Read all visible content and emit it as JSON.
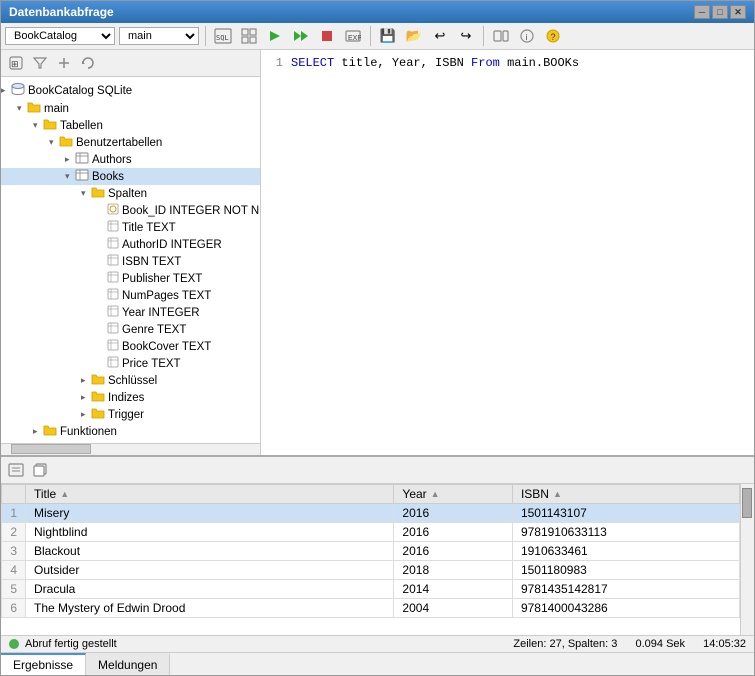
{
  "window": {
    "title": "Datenbankabfrage"
  },
  "toolbar": {
    "db_value": "BookCatalog",
    "schema_value": "main",
    "buttons": [
      "filter",
      "add",
      "refresh"
    ]
  },
  "tree": {
    "items": [
      {
        "id": "bookcatalog",
        "label": "BookCatalog SQLite",
        "indent": 0,
        "type": "db",
        "toggle": "▸"
      },
      {
        "id": "main",
        "label": "main",
        "indent": 1,
        "type": "schema",
        "toggle": "▾"
      },
      {
        "id": "tabellen",
        "label": "Tabellen",
        "indent": 2,
        "type": "folder",
        "toggle": "▾"
      },
      {
        "id": "benutzertabellen",
        "label": "Benutzertabellen",
        "indent": 3,
        "type": "folder",
        "toggle": "▾"
      },
      {
        "id": "authors",
        "label": "Authors",
        "indent": 4,
        "type": "table",
        "toggle": "▸"
      },
      {
        "id": "books",
        "label": "Books",
        "indent": 4,
        "type": "table",
        "toggle": "▾",
        "selected": true
      },
      {
        "id": "spalten",
        "label": "Spalten",
        "indent": 5,
        "type": "folder",
        "toggle": "▾"
      },
      {
        "id": "col_bookid",
        "label": "Book_ID INTEGER NOT NULL",
        "indent": 6,
        "type": "pk_col"
      },
      {
        "id": "col_title",
        "label": "Title TEXT",
        "indent": 6,
        "type": "col"
      },
      {
        "id": "col_authorid",
        "label": "AuthorID INTEGER",
        "indent": 6,
        "type": "col"
      },
      {
        "id": "col_isbn",
        "label": "ISBN TEXT",
        "indent": 6,
        "type": "col"
      },
      {
        "id": "col_publisher",
        "label": "Publisher TEXT",
        "indent": 6,
        "type": "col"
      },
      {
        "id": "col_numpages",
        "label": "NumPages TEXT",
        "indent": 6,
        "type": "col"
      },
      {
        "id": "col_year",
        "label": "Year INTEGER",
        "indent": 6,
        "type": "col"
      },
      {
        "id": "col_genre",
        "label": "Genre TEXT",
        "indent": 6,
        "type": "col"
      },
      {
        "id": "col_bookcover",
        "label": "BookCover TEXT",
        "indent": 6,
        "type": "col"
      },
      {
        "id": "col_price",
        "label": "Price TEXT",
        "indent": 6,
        "type": "col"
      },
      {
        "id": "schluessel",
        "label": "Schlüssel",
        "indent": 5,
        "type": "folder",
        "toggle": "▸"
      },
      {
        "id": "indizes",
        "label": "Indizes",
        "indent": 5,
        "type": "folder",
        "toggle": "▸"
      },
      {
        "id": "trigger",
        "label": "Trigger",
        "indent": 5,
        "type": "folder",
        "toggle": "▸"
      },
      {
        "id": "funktionen",
        "label": "Funktionen",
        "indent": 2,
        "type": "folder",
        "toggle": "▸"
      }
    ]
  },
  "editor": {
    "line1": "SELECT title, Year, ISBN From main.BOOKs"
  },
  "results": {
    "columns": [
      "Title",
      "Year",
      "ISBN"
    ],
    "rows": [
      {
        "num": 1,
        "title": "Misery",
        "year": "2016",
        "isbn": "1501143107",
        "selected": true
      },
      {
        "num": 2,
        "title": "Nightblind",
        "year": "2016",
        "isbn": "9781910633113"
      },
      {
        "num": 3,
        "title": "Blackout",
        "year": "2016",
        "isbn": "1910633461"
      },
      {
        "num": 4,
        "title": "Outsider",
        "year": "2018",
        "isbn": "1501180983"
      },
      {
        "num": 5,
        "title": "Dracula",
        "year": "2014",
        "isbn": "9781435142817"
      },
      {
        "num": 6,
        "title": "The Mystery of Edwin Drood",
        "year": "2004",
        "isbn": "9781400043286"
      }
    ]
  },
  "status": {
    "message": "Abruf fertig gestellt",
    "rows_cols": "Zeilen: 27, Spalten: 3",
    "duration": "0.094 Sek",
    "time": "14:05:32"
  },
  "tabs": [
    {
      "label": "Ergebnisse",
      "active": true
    },
    {
      "label": "Meldungen",
      "active": false
    }
  ]
}
